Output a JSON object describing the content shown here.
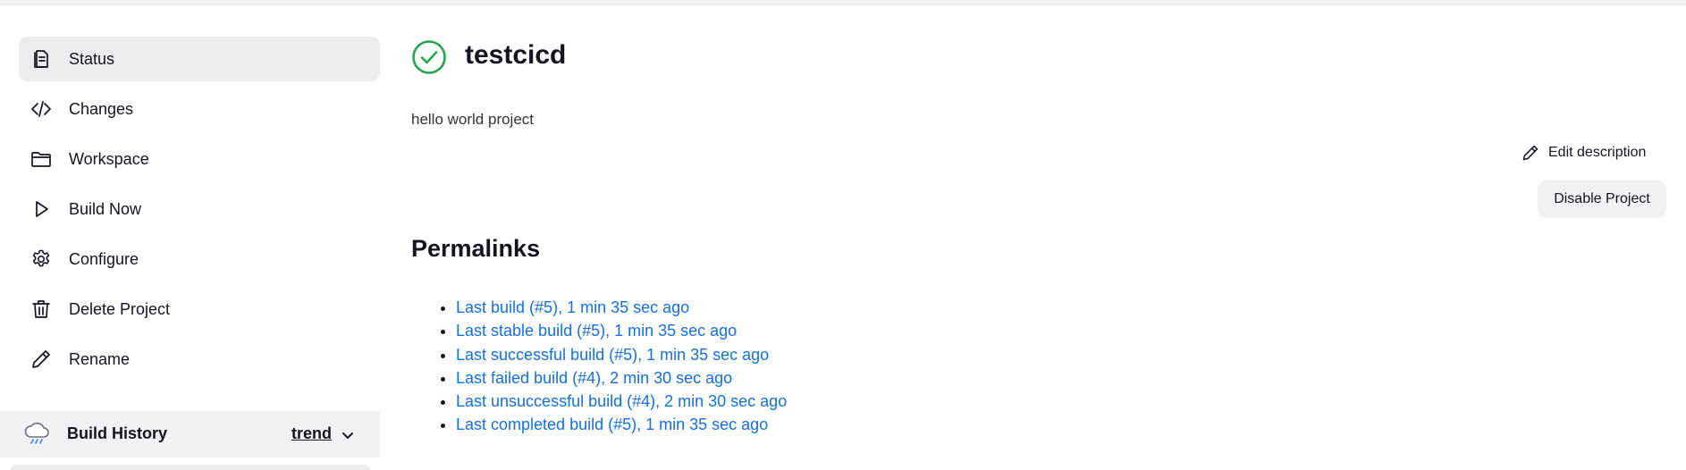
{
  "sidebar": {
    "items": [
      {
        "label": "Status",
        "icon": "status-icon"
      },
      {
        "label": "Changes",
        "icon": "code-icon"
      },
      {
        "label": "Workspace",
        "icon": "folder-icon"
      },
      {
        "label": "Build Now",
        "icon": "play-icon"
      },
      {
        "label": "Configure",
        "icon": "gear-icon"
      },
      {
        "label": "Delete Project",
        "icon": "trash-icon"
      },
      {
        "label": "Rename",
        "icon": "pencil-icon"
      }
    ],
    "active": "Status"
  },
  "build_history": {
    "title": "Build History",
    "trend_label": "trend",
    "icon": "cloud-rain-icon"
  },
  "main": {
    "job_title": "testcicd",
    "status": "success",
    "description": "hello world project",
    "edit_description_label": "Edit description",
    "disable_label": "Disable Project",
    "permalinks_title": "Permalinks",
    "permalinks": [
      "Last build (#5), 1 min 35 sec ago",
      "Last stable build (#5), 1 min 35 sec ago",
      "Last successful build (#5), 1 min 35 sec ago",
      "Last failed build (#4), 2 min 30 sec ago",
      "Last unsuccessful build (#4), 2 min 30 sec ago",
      "Last completed build (#5), 1 min 35 sec ago"
    ]
  },
  "colors": {
    "link": "#1670d8",
    "success": "#1ea64b",
    "active_bg": "#ececef",
    "panel_bg": "#f2f2f4"
  }
}
